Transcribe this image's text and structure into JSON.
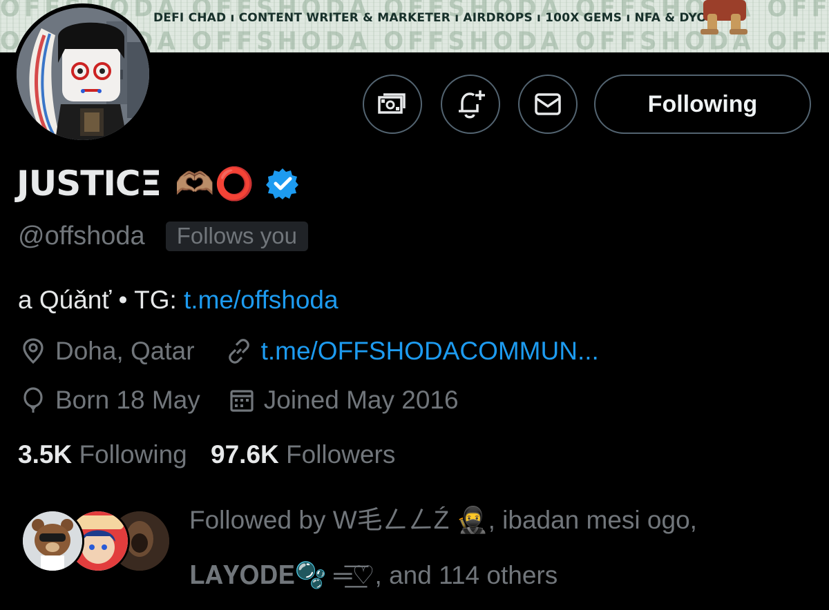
{
  "banner": {
    "tagline": "DEFI CHAD ı CONTENT WRITER & MARKETER ı AIRDROPS ı 100X GEMS ı NFA & DYOR",
    "watermark": "OFFSHODA"
  },
  "actions": {
    "tip_icon": "money-icon",
    "notify_icon": "bell-plus-icon",
    "message_icon": "envelope-icon",
    "follow_label": "Following"
  },
  "profile": {
    "display_name": "JUSTICΞ",
    "name_emojis": "🫶🏽⭕",
    "handle": "@offshoda",
    "follows_you": "Follows you",
    "bio_prefix": "a Qúǎnť • TG: ",
    "bio_link": "t.me/offshoda",
    "location": "Doha, Qatar",
    "website": "t.me/OFFSHODACOMMUN...",
    "birthday": "Born 18 May",
    "joined": "Joined May 2016",
    "verified_color": "#1d9bf0"
  },
  "stats": {
    "following_count": "3.5K",
    "following_label": "Following",
    "followers_count": "97.6K",
    "followers_label": "Followers"
  },
  "followed_by": {
    "line1": "Followed by W毛ㄥㄥŹ 🥷, ibadan mesi ogo,",
    "line2": "𝐋𝐀𝐘𝐎𝐃𝐄🫧 ═͟͟͞͞♡, and 114 others"
  },
  "colors": {
    "accent": "#1d9bf0",
    "secondary_text": "#71767b",
    "primary_text": "#e7e9ea",
    "border": "#536471"
  }
}
